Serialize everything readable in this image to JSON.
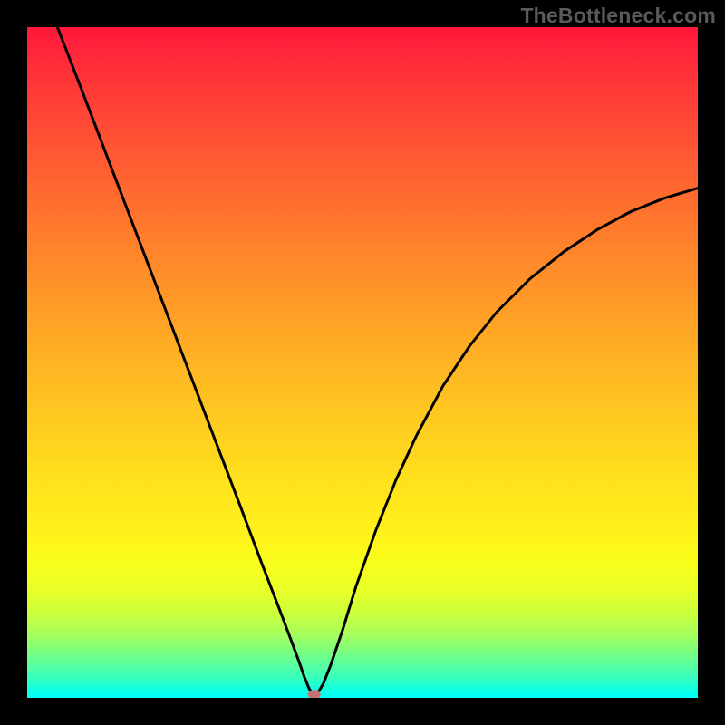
{
  "watermark": "TheBottleneck.com",
  "chart_data": {
    "type": "line",
    "title": "",
    "xlabel": "",
    "ylabel": "",
    "xlim": [
      0,
      100
    ],
    "ylim": [
      0,
      100
    ],
    "legend": false,
    "grid": false,
    "curve_points": [
      {
        "x": 4.5,
        "y": 100
      },
      {
        "x": 8,
        "y": 91
      },
      {
        "x": 12,
        "y": 80.5
      },
      {
        "x": 16,
        "y": 70
      },
      {
        "x": 20,
        "y": 59.5
      },
      {
        "x": 24,
        "y": 49
      },
      {
        "x": 28,
        "y": 38.5
      },
      {
        "x": 32,
        "y": 28
      },
      {
        "x": 35,
        "y": 20
      },
      {
        "x": 37.5,
        "y": 13.5
      },
      {
        "x": 39.2,
        "y": 9
      },
      {
        "x": 40.5,
        "y": 5.5
      },
      {
        "x": 41.3,
        "y": 3.2
      },
      {
        "x": 41.9,
        "y": 1.7
      },
      {
        "x": 42.3,
        "y": 0.9
      },
      {
        "x": 42.6,
        "y": 0.5
      },
      {
        "x": 43.0,
        "y": 0.5
      },
      {
        "x": 43.5,
        "y": 1.0
      },
      {
        "x": 44.2,
        "y": 2.2
      },
      {
        "x": 45.3,
        "y": 5
      },
      {
        "x": 47,
        "y": 10
      },
      {
        "x": 49,
        "y": 16.5
      },
      {
        "x": 52,
        "y": 25
      },
      {
        "x": 55,
        "y": 32.5
      },
      {
        "x": 58,
        "y": 39
      },
      {
        "x": 62,
        "y": 46.5
      },
      {
        "x": 66,
        "y": 52.5
      },
      {
        "x": 70,
        "y": 57.5
      },
      {
        "x": 75,
        "y": 62.5
      },
      {
        "x": 80,
        "y": 66.5
      },
      {
        "x": 85,
        "y": 69.8
      },
      {
        "x": 90,
        "y": 72.5
      },
      {
        "x": 95,
        "y": 74.5
      },
      {
        "x": 100,
        "y": 76
      }
    ],
    "marker": {
      "x": 42.8,
      "y": 0.5,
      "color": "#c9706e"
    },
    "gradient_stops": [
      {
        "pos": 0,
        "color": "#ff173b"
      },
      {
        "pos": 50,
        "color": "#ffc122"
      },
      {
        "pos": 80,
        "color": "#f9ff1b"
      },
      {
        "pos": 100,
        "color": "#00fff6"
      }
    ]
  }
}
